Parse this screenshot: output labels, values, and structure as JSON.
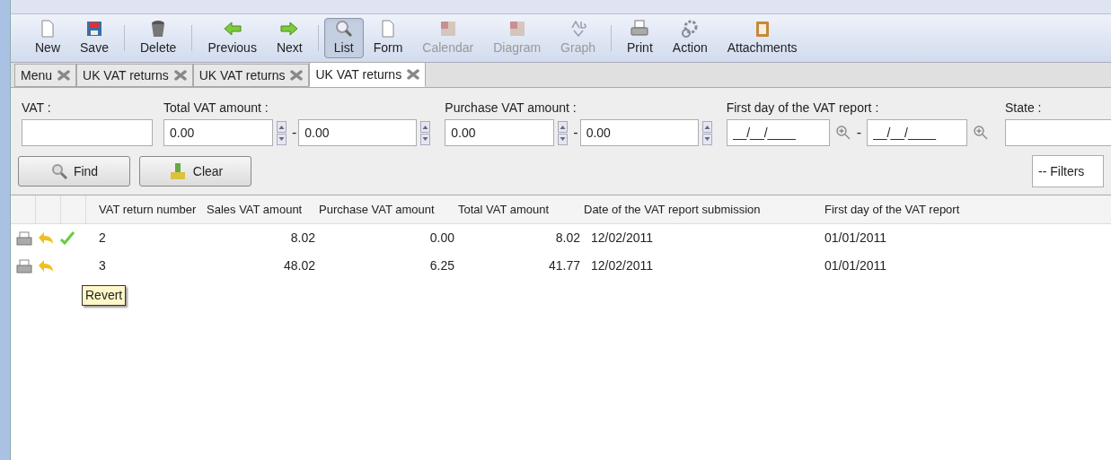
{
  "toolbar": [
    {
      "label": "New",
      "selected": false,
      "disabled": false
    },
    {
      "label": "Save",
      "selected": false,
      "disabled": false
    },
    {
      "label": "Delete",
      "selected": false,
      "disabled": false
    },
    {
      "label": "Previous",
      "selected": false,
      "disabled": false
    },
    {
      "label": "Next",
      "selected": false,
      "disabled": false
    },
    {
      "label": "List",
      "selected": true,
      "disabled": false
    },
    {
      "label": "Form",
      "selected": false,
      "disabled": false
    },
    {
      "label": "Calendar",
      "selected": false,
      "disabled": true
    },
    {
      "label": "Diagram",
      "selected": false,
      "disabled": true
    },
    {
      "label": "Graph",
      "selected": false,
      "disabled": true
    },
    {
      "label": "Print",
      "selected": false,
      "disabled": false
    },
    {
      "label": "Action",
      "selected": false,
      "disabled": false
    },
    {
      "label": "Attachments",
      "selected": false,
      "disabled": false
    }
  ],
  "tabs": [
    {
      "label": "Menu",
      "selected": false
    },
    {
      "label": "UK VAT returns",
      "selected": false
    },
    {
      "label": "UK VAT returns",
      "selected": false
    },
    {
      "label": "UK VAT returns",
      "selected": true
    }
  ],
  "filters": [
    {
      "kind": "text",
      "label": "VAT :"
    },
    {
      "kind": "range",
      "label": "Total VAT amount :",
      "from": "0.00",
      "dash": "-",
      "to": "0.00"
    },
    {
      "kind": "range",
      "label": "Purchase VAT amount :",
      "from": "0.00",
      "dash": "-",
      "to": "0.00"
    },
    {
      "kind": "date",
      "label": "First day of the VAT report :",
      "from": "__/__/____",
      "dash": "-",
      "to": "__/__/____"
    },
    {
      "kind": "text",
      "label": "State :"
    }
  ],
  "find_button": {
    "label": "Find"
  },
  "clear_button": {
    "label": "Clear"
  },
  "filters_dropdown": {
    "value": "-- Filters"
  },
  "table": {
    "columns": [
      "VAT return number",
      "Sales VAT amount",
      "Purchase VAT amount",
      "Total VAT amount",
      "Date of the VAT report submission",
      "First day of the VAT report"
    ],
    "rows": [
      {
        "validated": true,
        "cells": [
          "2",
          "8.02",
          "0.00",
          "8.02",
          "12/02/2011",
          "01/01/2011"
        ]
      },
      {
        "validated": false,
        "cells": [
          "3",
          "48.02",
          "6.25",
          "41.77",
          "12/02/2011",
          "01/01/2011"
        ]
      }
    ]
  },
  "tooltip": {
    "text": "Revert"
  }
}
